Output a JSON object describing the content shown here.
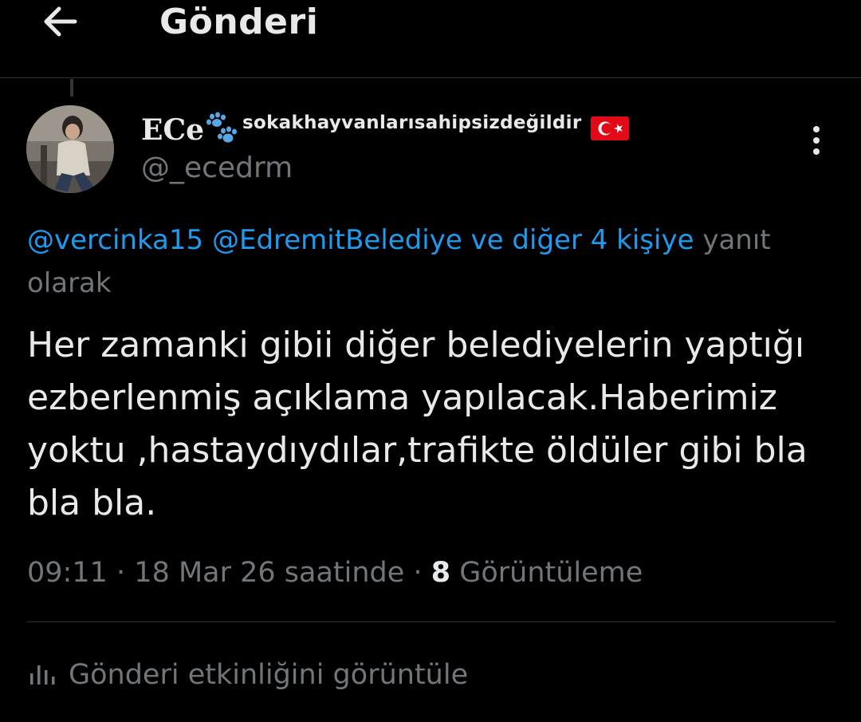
{
  "header": {
    "title": "Gönderi",
    "back_icon": "arrow-left-icon"
  },
  "post": {
    "author": {
      "display_name_main": "ECe",
      "display_name_suffix": "sokakhayvanlarısahipsizdeğildir",
      "handle": "@_ecedrm",
      "emoji_icons": [
        "paw-prints-icon",
        "turkey-flag-icon"
      ]
    },
    "reply_context": {
      "mention_1": "@vercinka15",
      "mention_2": "@EdremitBelediye",
      "others_link": "ve diğer 4 kişiye",
      "suffix": "yanıt olarak"
    },
    "text": "Her zamanki gibii diğer belediyelerin yaptığı ezberlenmiş açıklama yapılacak.Haberimiz yoktu ,hastaydıydılar,trafikte öldüler gibi bla bla bla.",
    "meta": {
      "time": "09:11",
      "separator": "·",
      "date": "18 Mar 26 saatinde",
      "view_count": "8",
      "views_label": "Görüntüleme"
    },
    "activity_label": "Gönderi etkinliğini görüntüle"
  },
  "colors": {
    "background": "#000000",
    "text_primary": "#e7e9ea",
    "text_secondary": "#71767b",
    "link": "#1d9bf0",
    "divider": "#2f3336"
  }
}
